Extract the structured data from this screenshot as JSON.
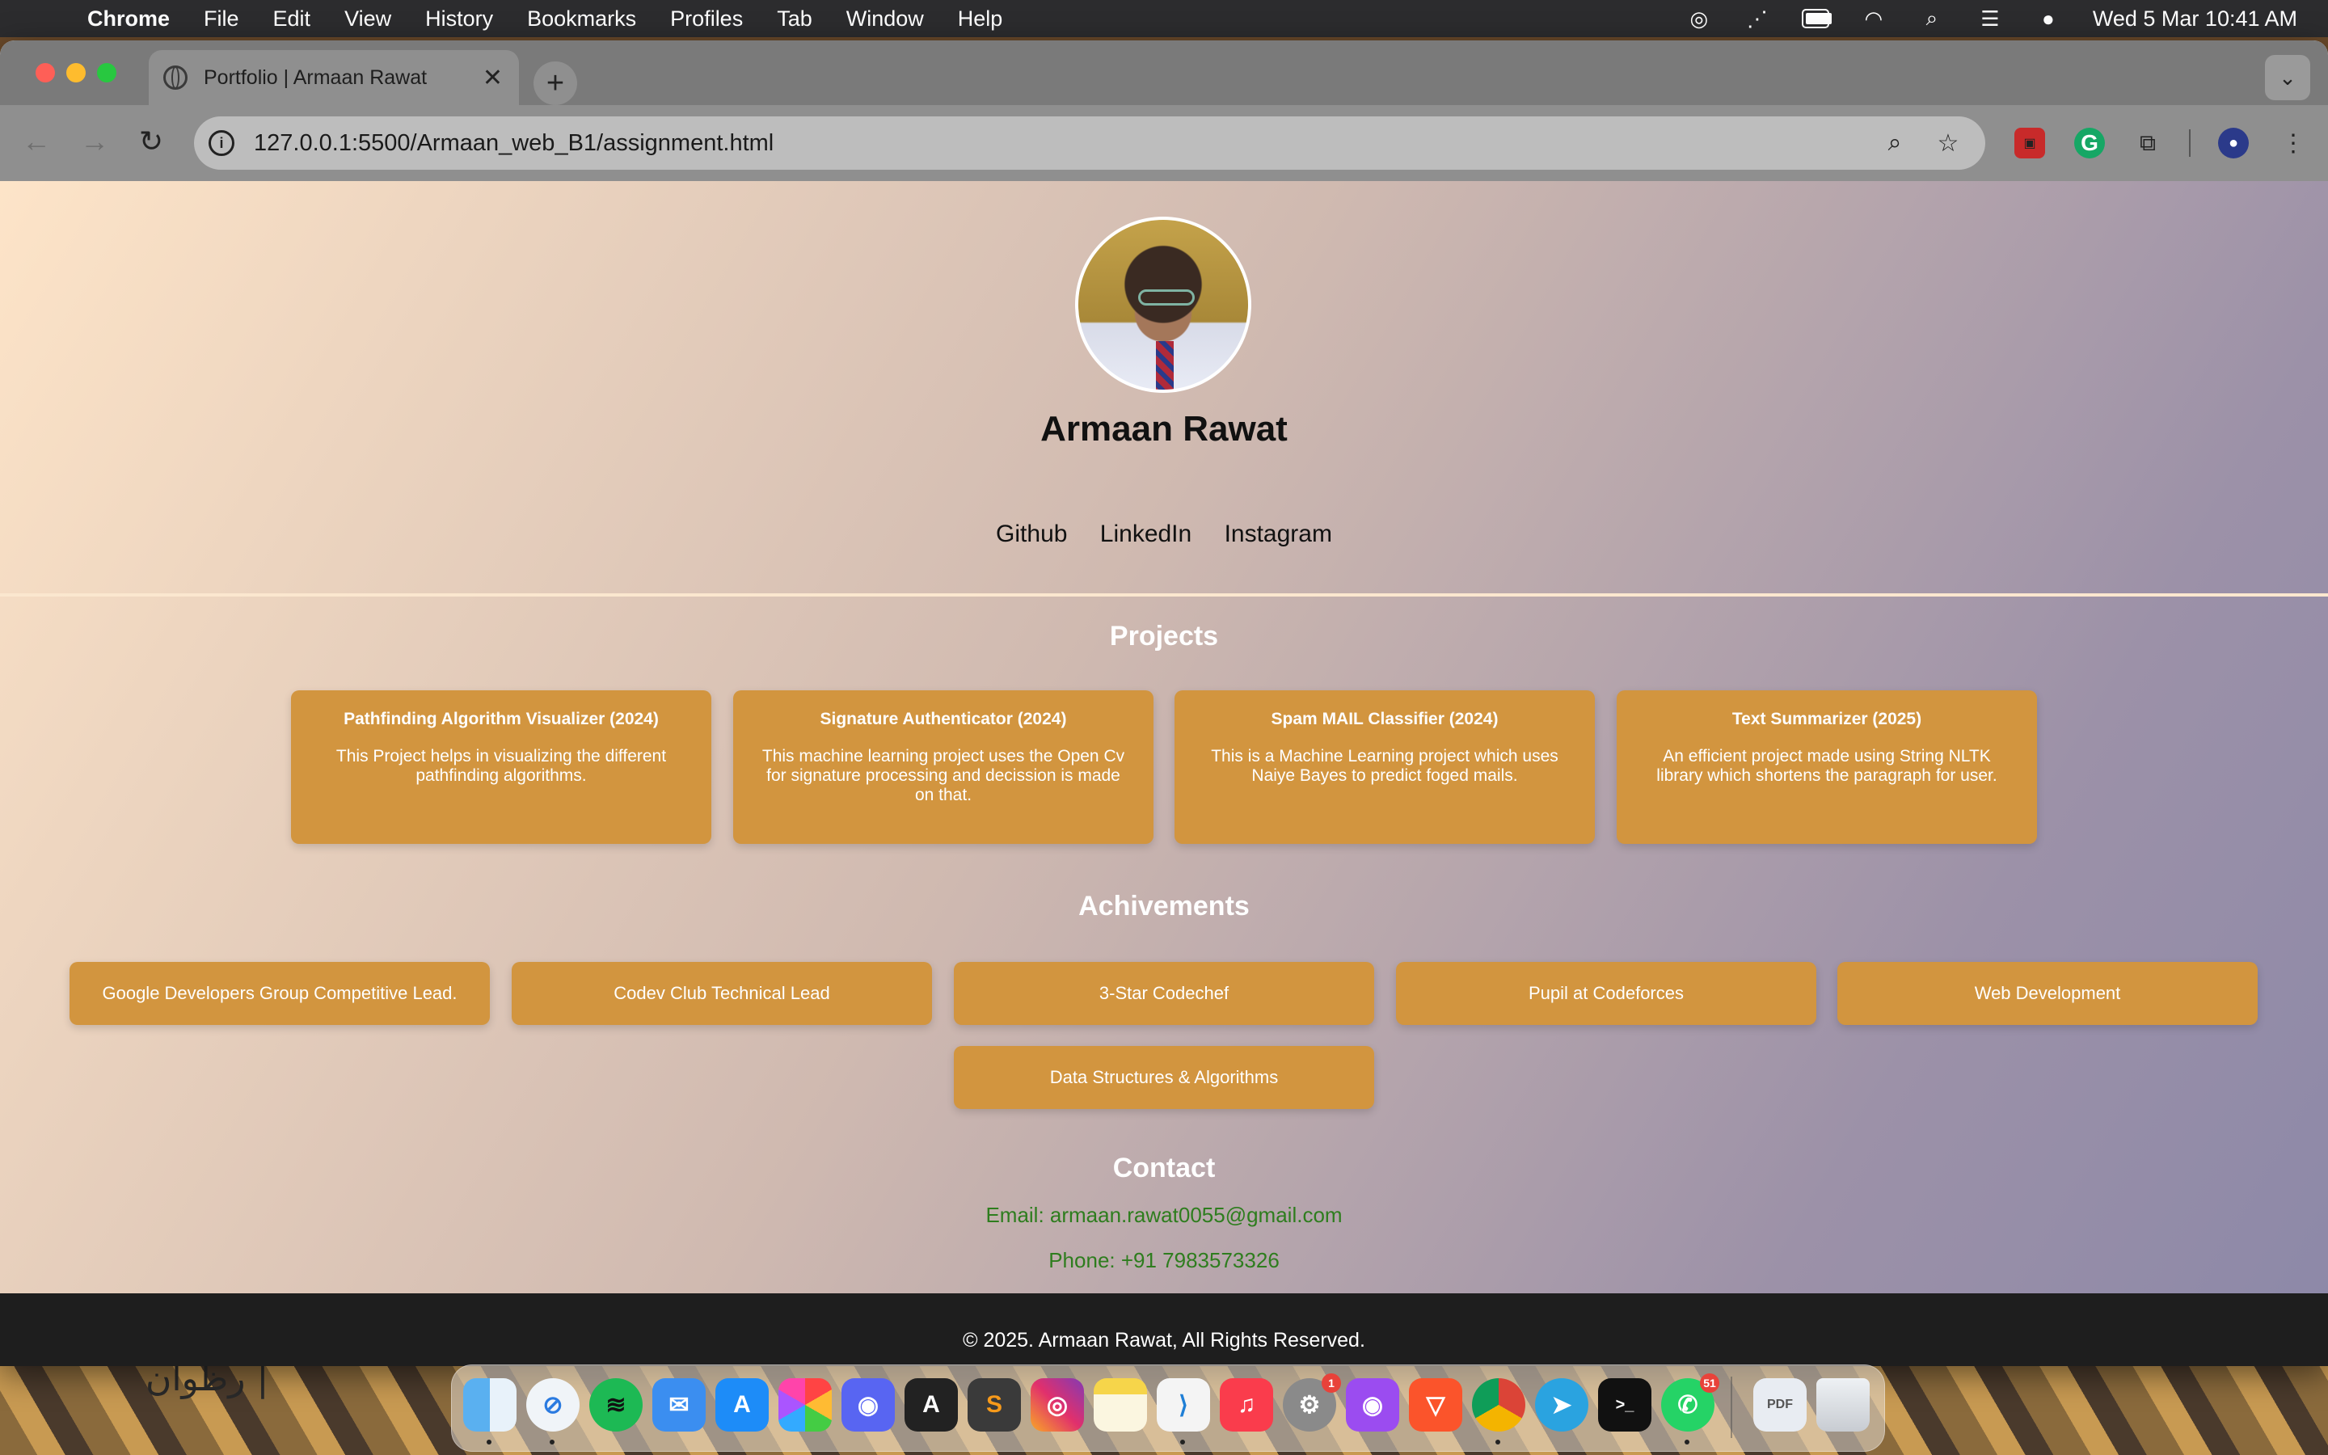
{
  "menubar": {
    "app_name": "Chrome",
    "items": [
      "File",
      "Edit",
      "View",
      "History",
      "Bookmarks",
      "Profiles",
      "Tab",
      "Window",
      "Help"
    ],
    "datetime": "Wed 5 Mar  10:41 AM"
  },
  "browser": {
    "tab_title": "Portfolio | Armaan Rawat",
    "url": "127.0.0.1:5500/Armaan_web_B1/assignment.html"
  },
  "profile": {
    "name": "Armaan Rawat",
    "links": [
      "Github",
      "LinkedIn",
      "Instagram"
    ]
  },
  "projects": {
    "title": "Projects",
    "items": [
      {
        "title": "Pathfinding Algorithm Visualizer (2024)",
        "description": "This Project helps in visualizing the different pathfinding algorithms."
      },
      {
        "title": "Signature Authenticator (2024)",
        "description": "This machine learning project uses the Open Cv for signature processing and decission is made on that."
      },
      {
        "title": "Spam MAIL Classifier (2024)",
        "description": "This is a Machine Learning project which uses Naiye Bayes to predict foged mails."
      },
      {
        "title": "Text Summarizer (2025)",
        "description": "An efficient project made using String NLTK library which shortens the paragraph for user."
      }
    ]
  },
  "achievements": {
    "title": "Achivements",
    "items": [
      "Google Developers Group Competitive Lead.",
      "Codev Club Technical Lead",
      "3-Star Codechef",
      "Pupil at Codeforces",
      "Web Development",
      "Data Structures & Algorithms"
    ]
  },
  "contact": {
    "title": "Contact",
    "email": "Email: armaan.rawat0055@gmail.com",
    "phone": "Phone: +91 7983573326"
  },
  "footer": {
    "text": "© 2025. Armaan Rawat, All Rights Reserved."
  },
  "wallpaper_text": "رظوان |",
  "dock": {
    "apps": [
      "finder",
      "safari",
      "spotify",
      "mail",
      "app-store",
      "photos",
      "discord",
      "dictionary",
      "sublime-text",
      "instagram",
      "notes",
      "vscode",
      "music",
      "system-settings",
      "podcasts",
      "brave",
      "chrome",
      "telegram",
      "terminal",
      "whatsapp",
      "pdf-document",
      "trash"
    ],
    "system_settings_badge": "1",
    "whatsapp_badge": "51"
  }
}
